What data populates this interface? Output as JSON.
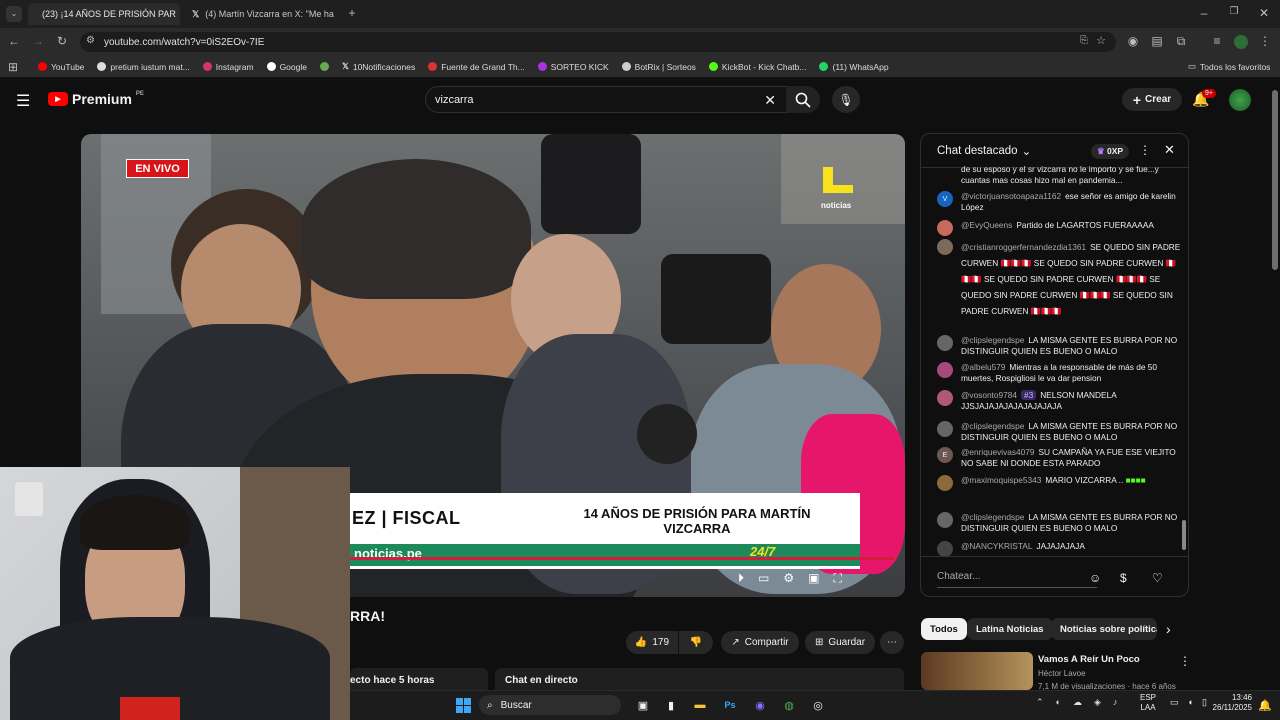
{
  "browser": {
    "tabs": [
      {
        "title": "(23) ¡14 AÑOS DE PRISIÓN PAR"
      },
      {
        "title": "(4) Martín Vizcarra en X: \"Me ha"
      }
    ],
    "url": "youtube.com/watch?v=0iS2EOv-7IE",
    "bookmarks": [
      "YouTube",
      "pretium iustum mat...",
      "Instagram",
      "Google",
      "",
      "10Notificaciones",
      "Fuente de Grand Th...",
      "SORTEO KICK",
      "BotRix | Sorteos",
      "KickBot - Kick Chatb...",
      "(11) WhatsApp"
    ],
    "all_favorites": "Todos los favoritos"
  },
  "youtube": {
    "logo": "Premium",
    "logo_country": "PE",
    "search_value": "vizcarra",
    "create_label": "Crear",
    "notif_count": "9+"
  },
  "video": {
    "live_badge": "EN VIVO",
    "channel_bug": "noticias",
    "lower_third_left": "EZ | FISCAL",
    "lower_third_right": "14 AÑOS DE PRISIÓN PARA MARTÍN VIZCARRA",
    "ticker_left": "noticias.pe",
    "ticker_right": "24/7",
    "title_fragment": "RRA!",
    "likes": "179",
    "share_label": "Compartir",
    "save_label": "Guardar",
    "started": "ecto hace 5 horas",
    "live_chat_label": "Chat en directo"
  },
  "chat": {
    "header": "Chat destacado",
    "points": "0XP",
    "input_placeholder": "Chatear...",
    "messages": [
      {
        "author": "",
        "text": "de su esposo y el sr vizcarra no le importo y se fue...y cuantas mas cosas hizo mal en pandemia...",
        "avatar": ""
      },
      {
        "author": "@victorjuansotoapaza1162",
        "text": "ese señor es amigo de karelin López",
        "avatar": "V"
      },
      {
        "author": "@EvyQueens",
        "text": "Partido de LAGARTOS FUERAAAAA",
        "avatar": ""
      },
      {
        "author": "@cristianroggerfernandezdia1361",
        "text": "SE QUEDO SIN PADRE CURWEN 🇵🇪🇵🇪🇵🇪 SE QUEDO SIN PADRE CURWEN 🇵🇪🇵🇪🇵🇪 SE QUEDO SIN PADRE CURWEN 🇵🇪🇵🇪🇵🇪 SE QUEDO SIN PADRE CURWEN 🇵🇪🇵🇪🇵🇪 SE QUEDO SIN PADRE CURWEN 🇵🇪🇵🇪🇵🇪",
        "avatar": ""
      },
      {
        "author": "@clipslegendspe",
        "text": "LA MISMA GENTE ES BURRA POR NO DISTINGUIR QUIEN ES BUENO O MALO",
        "avatar": ""
      },
      {
        "author": "@albelu579",
        "text": "Mientras a la responsable de más de 50 muertes, Rospigliosi le va dar pension",
        "avatar": ""
      },
      {
        "author": "@vosonto9784",
        "badge": "#3",
        "text": "NELSON MANDELA JJSJAJAJAJAJAJAJAJAJA",
        "avatar": ""
      },
      {
        "author": "@clipslegendspe",
        "text": "LA MISMA GENTE ES BURRA POR NO DISTINGUIR QUIEN ES BUENO O MALO",
        "avatar": ""
      },
      {
        "author": "@enriquevivas4079",
        "text": "SU CAMPAÑA YA FUE ESE VIEJITO NO SABE NI DONDE ESTA PARADO",
        "avatar": "E"
      },
      {
        "author": "@maximoquispe5343",
        "text": "MARIO VIZCARRA ..",
        "avatar": ""
      },
      {
        "author": "@clipslegendspe",
        "text": "LA MISMA GENTE ES BURRA POR NO DISTINGUIR QUIEN ES BUENO O MALO",
        "avatar": ""
      },
      {
        "author": "@NANCYKRISTAL",
        "text": "JAJAJAJAJA",
        "avatar": ""
      }
    ]
  },
  "chips": [
    "Todos",
    "Latina Noticias",
    "Noticias sobre política"
  ],
  "recommendation": {
    "title": "Vamos A Reír Un Poco",
    "channel": "Héctor Lavoe",
    "meta": "7,1 M de visualizaciones · hace 6 años"
  },
  "taskbar": {
    "search": "Buscar",
    "lang1": "ESP",
    "lang2": "LAA",
    "time": "13:46",
    "date": "26/11/2025"
  },
  "colors": {
    "yt_red": "#ff0000",
    "live_red": "#d81418",
    "ticker_green": "#1d8a5b"
  }
}
